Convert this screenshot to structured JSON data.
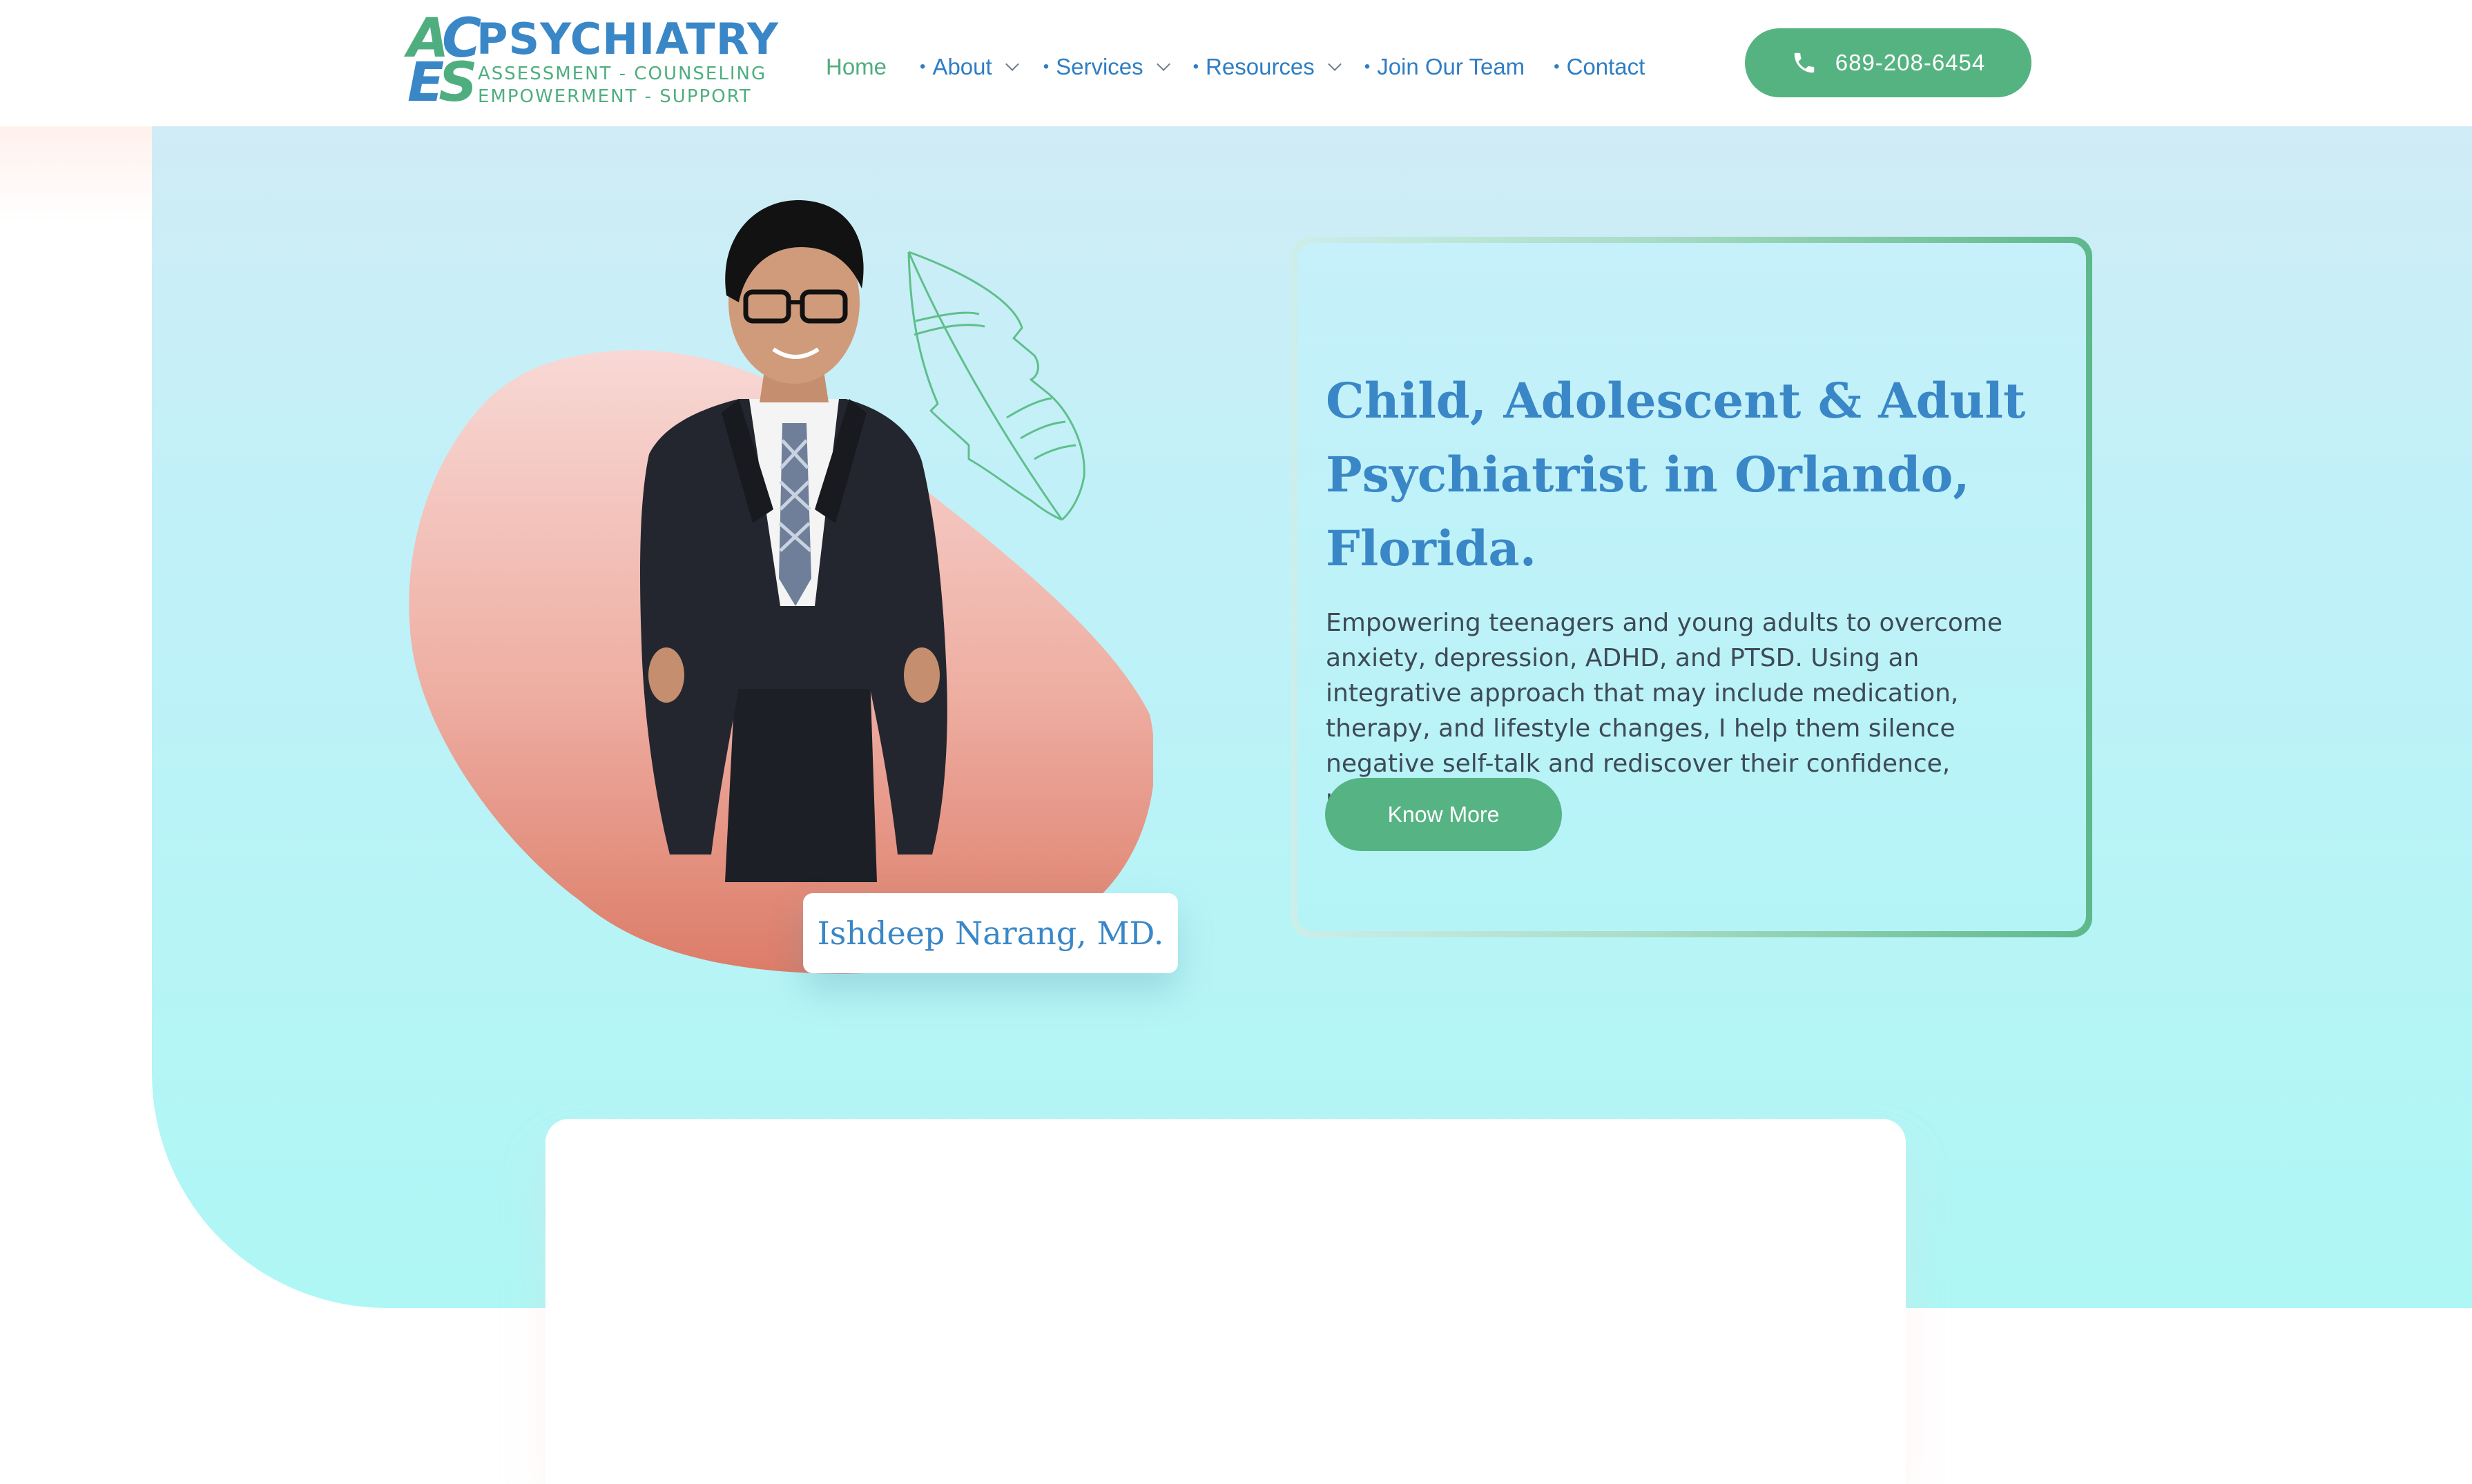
{
  "header": {
    "logo": {
      "mark_top_left": "A",
      "mark_top_right": "C",
      "mark_bottom_left": "E",
      "mark_bottom_right": "S",
      "title": "PSYCHIATRY",
      "subtitle_line1": "ASSESSMENT - COUNSELING",
      "subtitle_line2": "EMPOWERMENT - SUPPORT"
    },
    "nav": {
      "home": "Home",
      "about": "About",
      "services": "Services",
      "resources": "Resources",
      "join": "Join Our Team",
      "contact": "Contact"
    },
    "phone": "689-208-6454"
  },
  "hero": {
    "doctor_name": "Ishdeep Narang, MD.",
    "title_line1": "Child, Adolescent & Adult",
    "title_strong": "Psychiatrist",
    "title_rest": " in Orlando, Florida.",
    "description": "Empowering teenagers and young adults to overcome anxiety, depression, ADHD, and PTSD. Using an integrative approach that may include medication, therapy, and lifestyle changes, I help them silence negative self-talk and rediscover their confidence, purpose, and joy.",
    "cta": "Know More"
  },
  "colors": {
    "brand_blue": "#3a87c7",
    "brand_green": "#55b382",
    "hero_bg_top": "#d0ecf6",
    "hero_bg_bottom": "#aef7f5",
    "blob_top": "#f8d8d5",
    "blob_bottom": "#e0806c"
  },
  "icons": {
    "phone": "phone-icon",
    "chevron": "chevron-down-icon",
    "leaf": "leaf-outline-icon"
  }
}
